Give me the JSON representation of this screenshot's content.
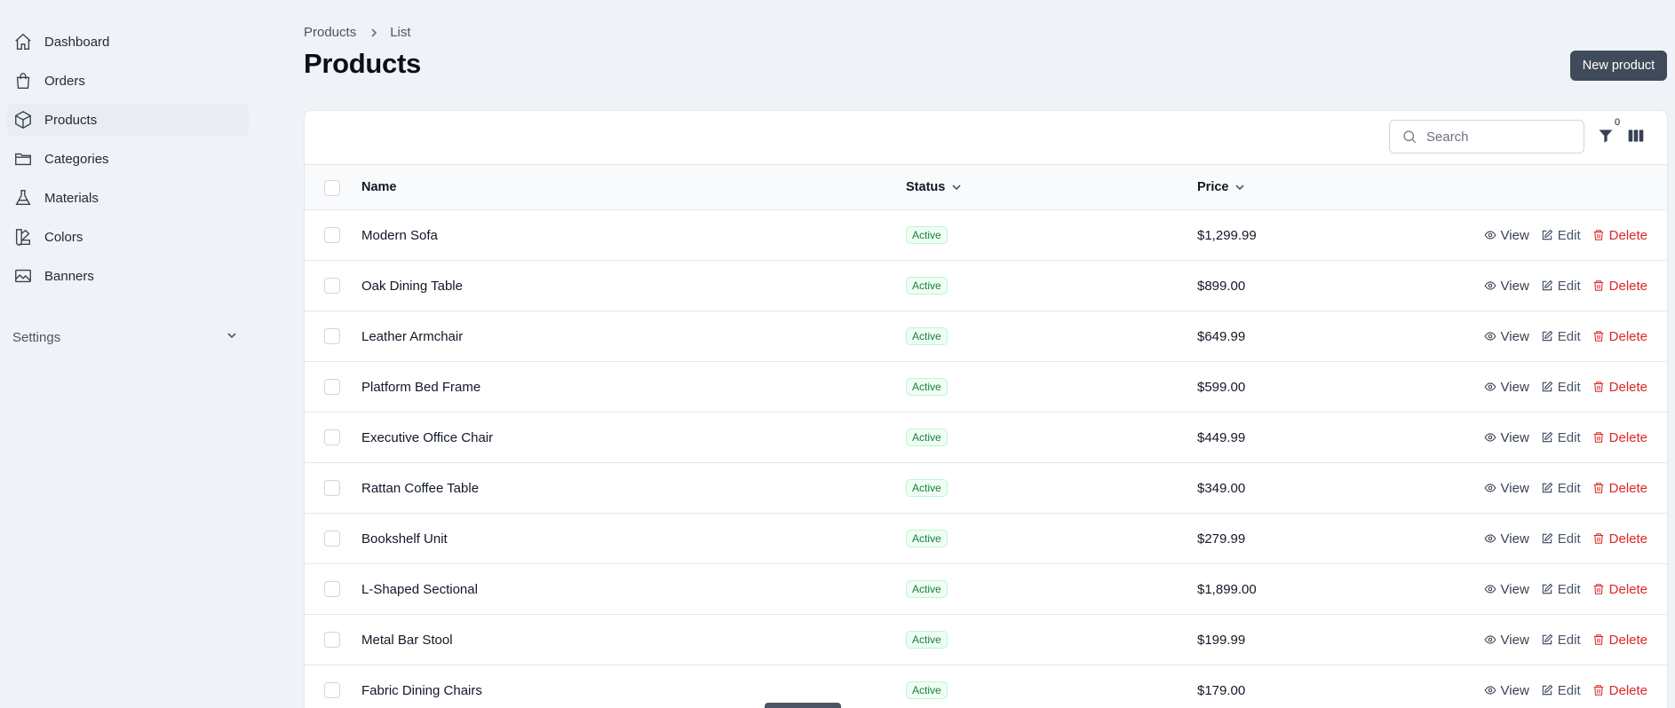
{
  "sidebar": {
    "items": [
      {
        "label": "Dashboard",
        "icon": "home-icon"
      },
      {
        "label": "Orders",
        "icon": "shopping-bag-icon"
      },
      {
        "label": "Products",
        "icon": "cube-icon",
        "active": true
      },
      {
        "label": "Categories",
        "icon": "folder-icon"
      },
      {
        "label": "Materials",
        "icon": "flask-icon"
      },
      {
        "label": "Colors",
        "icon": "swatch-icon"
      },
      {
        "label": "Banners",
        "icon": "image-icon"
      }
    ],
    "settings_label": "Settings"
  },
  "breadcrumb": {
    "items": [
      "Products",
      "List"
    ]
  },
  "page": {
    "title": "Products",
    "new_button": "New product"
  },
  "toolbar": {
    "search_placeholder": "Search",
    "filter_count": "0"
  },
  "table": {
    "columns": {
      "name": "Name",
      "status": "Status",
      "price": "Price"
    },
    "actions": {
      "view": "View",
      "edit": "Edit",
      "delete": "Delete"
    },
    "rows": [
      {
        "name": "Modern Sofa",
        "status": "Active",
        "price": "$1,299.99"
      },
      {
        "name": "Oak Dining Table",
        "status": "Active",
        "price": "$899.00"
      },
      {
        "name": "Leather Armchair",
        "status": "Active",
        "price": "$649.99"
      },
      {
        "name": "Platform Bed Frame",
        "status": "Active",
        "price": "$599.00"
      },
      {
        "name": "Executive Office Chair",
        "status": "Active",
        "price": "$449.99"
      },
      {
        "name": "Rattan Coffee Table",
        "status": "Active",
        "price": "$349.00"
      },
      {
        "name": "Bookshelf Unit",
        "status": "Active",
        "price": "$279.99"
      },
      {
        "name": "L-Shaped Sectional",
        "status": "Active",
        "price": "$1,899.00"
      },
      {
        "name": "Metal Bar Stool",
        "status": "Active",
        "price": "$199.99"
      },
      {
        "name": "Fabric Dining Chairs",
        "status": "Active",
        "price": "$179.00"
      }
    ]
  },
  "colors": {
    "primary_button": "#3f4a5a",
    "danger": "#dc2626",
    "success": "#15803d",
    "background": "#eff2f6"
  }
}
